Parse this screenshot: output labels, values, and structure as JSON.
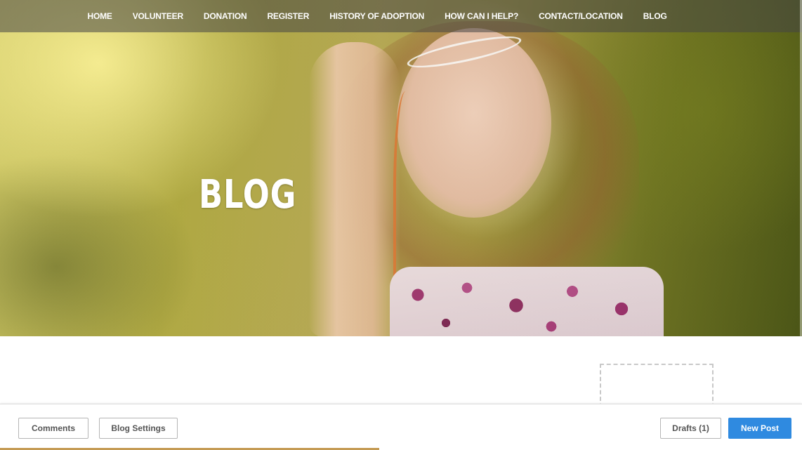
{
  "nav": {
    "items": [
      {
        "label": "HOME"
      },
      {
        "label": "VOLUNTEER"
      },
      {
        "label": "DONATION"
      },
      {
        "label": "REGISTER"
      },
      {
        "label": "HISTORY OF ADOPTION"
      },
      {
        "label": "HOW CAN I HELP?"
      },
      {
        "label": "CONTACT/LOCATION"
      },
      {
        "label": "BLOG"
      }
    ]
  },
  "hero": {
    "title": "BLOG"
  },
  "toolbar": {
    "comments_label": "Comments",
    "settings_label": "Blog Settings",
    "drafts_label": "Drafts (1)",
    "new_post_label": "New Post"
  },
  "colors": {
    "primary_button": "#2f8ae0",
    "nav_background": "rgba(70,70,70,0.55)",
    "accent": "#c49a52"
  }
}
